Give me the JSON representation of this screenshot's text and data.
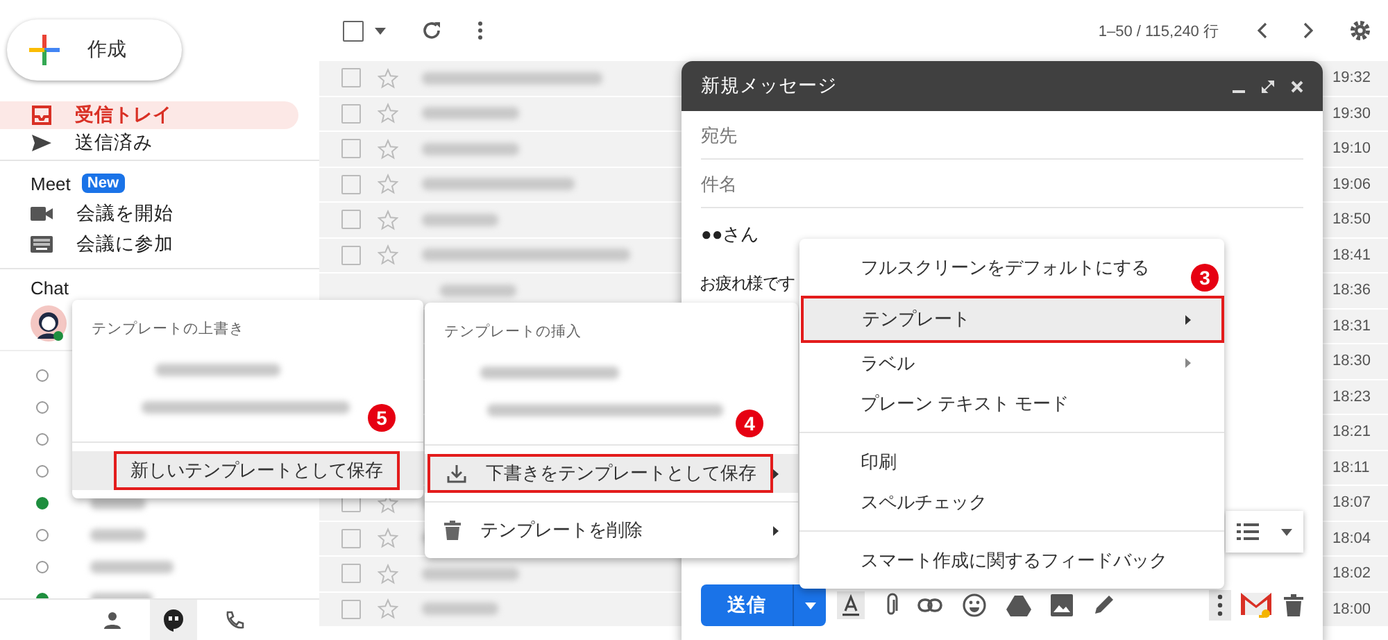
{
  "compose_button": {
    "label": "作成"
  },
  "nav": [
    {
      "label": "受信トレイ",
      "selected": true
    },
    {
      "label": "送信済み",
      "selected": false
    }
  ],
  "meet": {
    "title": "Meet",
    "badge": "New",
    "items": [
      {
        "label": "会議を開始",
        "kind": "video"
      },
      {
        "label": "会議に参加",
        "kind": "keyboard"
      }
    ]
  },
  "chat": {
    "title": "Chat",
    "contacts": [
      {
        "online": false
      },
      {
        "online": false
      },
      {
        "online": false
      },
      {
        "online": false
      },
      {
        "online": true
      },
      {
        "online": false
      },
      {
        "online": false
      },
      {
        "online": true
      }
    ]
  },
  "toolbar": {
    "select_all_checked": false,
    "pagination": "1–50 / 115,240 行"
  },
  "mail_rows": [
    {
      "checked": false,
      "time": "19:32"
    },
    {
      "checked": false,
      "time": "19:30"
    },
    {
      "checked": false,
      "time": "19:10"
    },
    {
      "checked": false,
      "time": "19:06"
    },
    {
      "checked": false,
      "time": "18:50"
    },
    {
      "checked": false,
      "time": "18:41"
    },
    {
      "time": "18:36"
    },
    {
      "time": "18:31"
    },
    {
      "time": "18:30"
    },
    {
      "time": "18:23"
    },
    {
      "time": "18:21"
    },
    {
      "time": "18:11"
    },
    {
      "checked": false,
      "time": "18:07"
    },
    {
      "checked": false,
      "time": "18:04"
    },
    {
      "checked": false,
      "time": "18:02"
    },
    {
      "checked": false,
      "time": "18:00"
    }
  ],
  "compose": {
    "title": "新規メッセージ",
    "to_placeholder": "宛先",
    "subject_placeholder": "件名",
    "body_lines": [
      "●●さん",
      "お疲れ様です"
    ],
    "send": "送信"
  },
  "more_menu": {
    "sections": [
      [
        {
          "label": "フルスクリーンをデフォルトにする",
          "selected": false,
          "submenu": false
        },
        {
          "label": "テンプレート",
          "selected": true,
          "submenu": true,
          "callout": "3"
        },
        {
          "label": "ラベル",
          "selected": false,
          "submenu": true
        },
        {
          "label": "プレーン テキスト モード",
          "selected": false,
          "submenu": false
        }
      ],
      [
        {
          "label": "印刷",
          "selected": false,
          "submenu": false
        },
        {
          "label": "スペルチェック",
          "selected": false,
          "submenu": false
        }
      ],
      [
        {
          "label": "スマート作成に関するフィードバック",
          "selected": false,
          "submenu": false
        }
      ]
    ]
  },
  "template_menu": {
    "header": "テンプレートの挿入",
    "items": [
      {
        "label": "下書きをテンプレートとして保存",
        "kind": "save",
        "selected": true,
        "submenu": true,
        "callout": "4"
      },
      {
        "label": "テンプレートを削除",
        "kind": "delete",
        "selected": false,
        "submenu": true
      }
    ]
  },
  "overwrite_menu": {
    "header": "テンプレートの上書き",
    "items": [
      {
        "label": "新しいテンプレートとして保存",
        "selected": true,
        "callout": "5"
      }
    ]
  }
}
